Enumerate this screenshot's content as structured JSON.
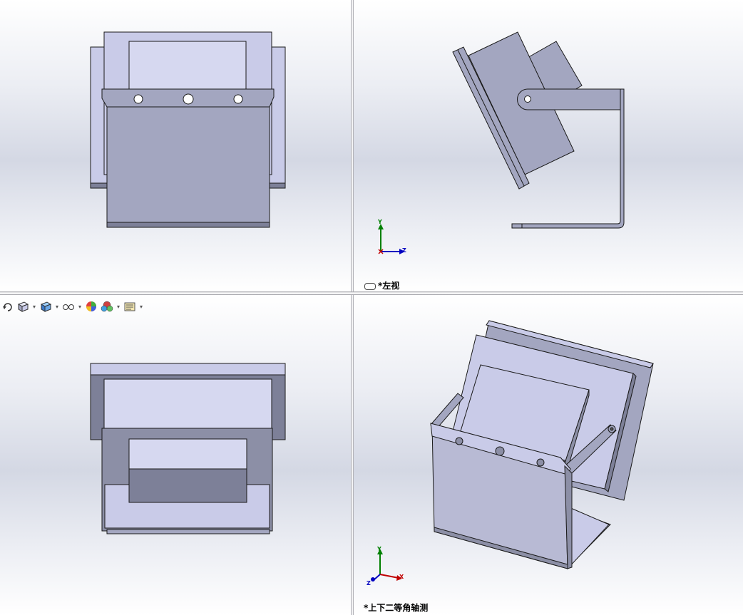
{
  "viewports": {
    "top_left": {},
    "top_right": {
      "view_name": "*左视"
    },
    "bottom_left": {},
    "bottom_right": {
      "view_name": "*上下二等角轴测"
    }
  },
  "triad": {
    "x_label": "X",
    "y_label": "Y",
    "z_label": "Z"
  },
  "heads_up_toolbar": [
    {
      "icon": "rotate-view-icon"
    },
    {
      "icon": "view-orientation-icon"
    },
    {
      "icon": "display-style-icon"
    },
    {
      "icon": "hide-show-items-icon"
    },
    {
      "icon": "edit-appearance-icon"
    },
    {
      "icon": "apply-scene-icon"
    },
    {
      "icon": "view-settings-icon"
    }
  ],
  "colors": {
    "part_light": "#c9cbe8",
    "part_mid": "#a3a6c0",
    "part_dark": "#7d8098",
    "edge": "#1a1a1a",
    "axis_x": "#c00000",
    "axis_y": "#008000",
    "axis_z": "#0000c0"
  }
}
